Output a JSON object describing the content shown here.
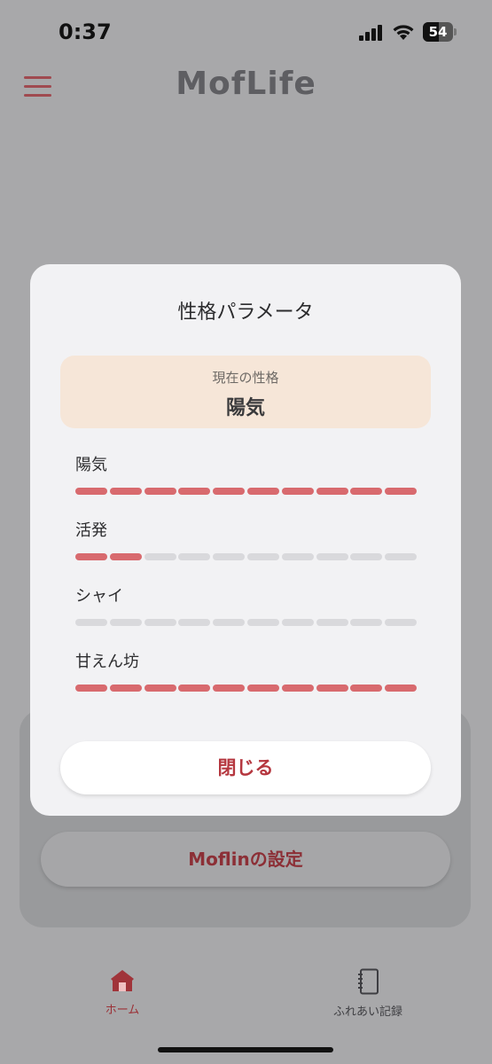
{
  "status_bar": {
    "time": "0:37",
    "battery": "54",
    "battery_level": 0.54
  },
  "header": {
    "app_name": "MofLife"
  },
  "modal": {
    "title": "性格パラメータ",
    "current_label": "現在の性格",
    "current_value": "陽気",
    "params": [
      {
        "label": "陽気",
        "level": 10,
        "max": 10
      },
      {
        "label": "活発",
        "level": 2,
        "max": 10
      },
      {
        "label": "シャイ",
        "level": 0,
        "max": 10
      },
      {
        "label": "甘えん坊",
        "level": 10,
        "max": 10
      }
    ],
    "close_label": "閉じる"
  },
  "background": {
    "moflin_settings_label": "Moflinの設定"
  },
  "bottom_nav": {
    "home_label": "ホーム",
    "records_label": "ふれあい記録"
  },
  "colors": {
    "accent": "#d86a6e",
    "accent_text": "#b5373f",
    "empty_segment": "#d9d9dc",
    "current_box": "#f6e6d8"
  },
  "icons": {
    "menu": "hamburger-icon",
    "home": "home-icon",
    "records": "notebook-icon"
  }
}
